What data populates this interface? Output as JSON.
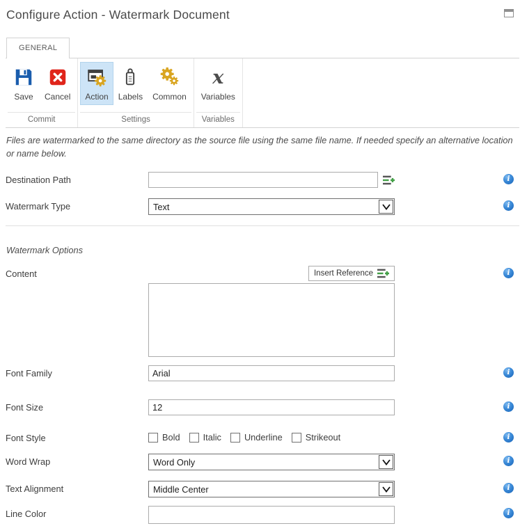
{
  "window": {
    "title": "Configure Action - Watermark Document"
  },
  "tab": {
    "label": "GENERAL"
  },
  "ribbon": {
    "groups": [
      {
        "label": "Commit",
        "buttons": [
          {
            "label": "Save",
            "icon": "save-floppy-icon"
          },
          {
            "label": "Cancel",
            "icon": "cancel-x-icon"
          }
        ]
      },
      {
        "label": "Settings",
        "buttons": [
          {
            "label": "Action",
            "icon": "action-window-gear-icon",
            "selected": true
          },
          {
            "label": "Labels",
            "icon": "labels-tag-icon"
          },
          {
            "label": "Common",
            "icon": "common-gears-icon"
          }
        ]
      },
      {
        "label": "Variables",
        "buttons": [
          {
            "label": "Variables",
            "icon": "variables-x-icon",
            "glyph": "x"
          }
        ]
      }
    ]
  },
  "description": "Files are watermarked to the same directory as the source file using the same file name. If needed specify an alternative location or name below.",
  "section": {
    "watermark_options": "Watermark Options"
  },
  "fields": {
    "destination_path": {
      "label": "Destination Path",
      "value": ""
    },
    "watermark_type": {
      "label": "Watermark Type",
      "value": "Text"
    },
    "content": {
      "label": "Content",
      "value": "",
      "insert_reference_label": "Insert Reference"
    },
    "font_family": {
      "label": "Font Family",
      "value": "Arial"
    },
    "font_size": {
      "label": "Font Size",
      "value": "12"
    },
    "font_style": {
      "label": "Font Style",
      "options": [
        {
          "label": "Bold",
          "checked": false
        },
        {
          "label": "Italic",
          "checked": false
        },
        {
          "label": "Underline",
          "checked": false
        },
        {
          "label": "Strikeout",
          "checked": false
        }
      ]
    },
    "word_wrap": {
      "label": "Word Wrap",
      "value": "Word Only"
    },
    "text_alignment": {
      "label": "Text Alignment",
      "value": "Middle Center"
    },
    "line_color": {
      "label": "Line Color",
      "value": ""
    }
  },
  "icons": {
    "info_glyph": "i"
  },
  "colors": {
    "selected_button_bg": "#cde4f7",
    "save_blue": "#1a5dad",
    "cancel_red": "#e0251b",
    "gear_gold": "#d9a521",
    "icon_dark": "#3f3f3f",
    "info_blue": "#1460b4",
    "insert_green": "#43a047",
    "border_gray": "#ababab"
  }
}
